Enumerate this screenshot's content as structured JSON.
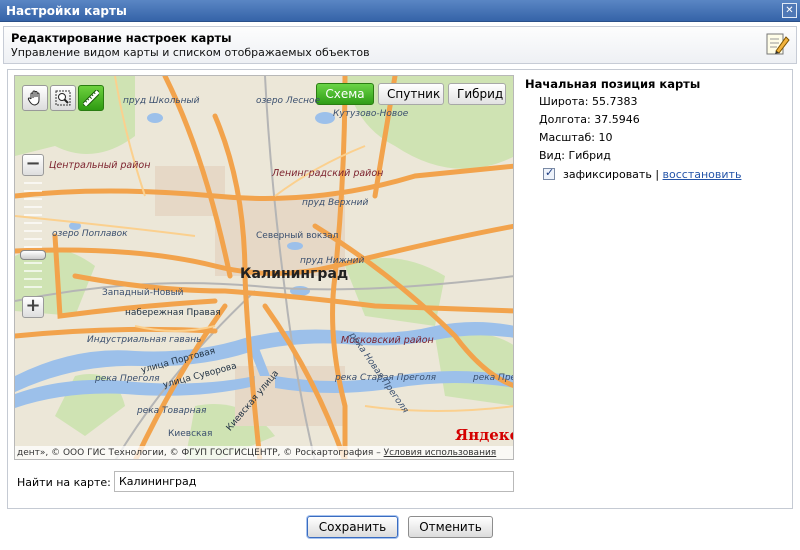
{
  "window": {
    "title": "Настройки карты",
    "close_glyph": "✕"
  },
  "header": {
    "title": "Редактирование настроек карты",
    "subtitle": "Управление видом карты и списком отображаемых объектов",
    "icon": "edit-icon"
  },
  "map": {
    "tools": [
      {
        "name": "hand-icon"
      },
      {
        "name": "zoom-rect-icon"
      },
      {
        "name": "ruler-icon"
      }
    ],
    "types": [
      "Схема",
      "Спутник",
      "Гибрид"
    ],
    "active_type": "Схема",
    "zoom_in": "+",
    "zoom_out": "−",
    "labels": {
      "city": "Калининград",
      "district_central": "Центральный район",
      "district_leningrad": "Ленинградский район",
      "district_moscow": "Московский район",
      "lake_lesnoe": "озеро Лесное",
      "lake_poplavok": "озеро Поплавок",
      "pond_school": "пруд Школьный",
      "pond_upper": "пруд Верхний",
      "pond_lower": "пруд Нижний",
      "kutuzovo": "Кутузово-Новое",
      "north_station": "Северный вокзал",
      "west_new": "Западный-Новый",
      "embankment": "набережная Правая",
      "industrial": "Индустриальная гавань",
      "street_portovaya": "улица Портовая",
      "street_suvorova": "улица Суворова",
      "street_kievskaya": "Киевская улица",
      "pond_tovarnaya": "река Товарная",
      "kievskaya": "Киевская",
      "river_novaya": "река Новая Преголя",
      "river_staraya": "река Старая Преголя",
      "river_pregolya": "река Преголя",
      "river_pregolya2": "река Преголя"
    },
    "brand": "Яндекс",
    "copyright": "дент», © ООО ГИС Технологии, © ФГУП ГОСГИСЦЕНТР, © Роскартография –",
    "terms": "Условия использования"
  },
  "position": {
    "title": "Начальная позиция карты",
    "lat": "Широта: 55.7383",
    "lon": "Долгота: 37.5946",
    "scale": "Масштаб: 10",
    "view": "Вид: Гибрид",
    "lock_label": "зафиксировать",
    "separator": "|",
    "restore": "восстановить"
  },
  "search": {
    "label": "Найти на карте:",
    "value": "Калининград"
  },
  "buttons": {
    "save": "Сохранить",
    "cancel": "Отменить"
  },
  "colors": {
    "titlebar": "#3a68ad",
    "active_button": "#3fae22",
    "road": "#f2a14a",
    "water": "#8eb7e6"
  }
}
